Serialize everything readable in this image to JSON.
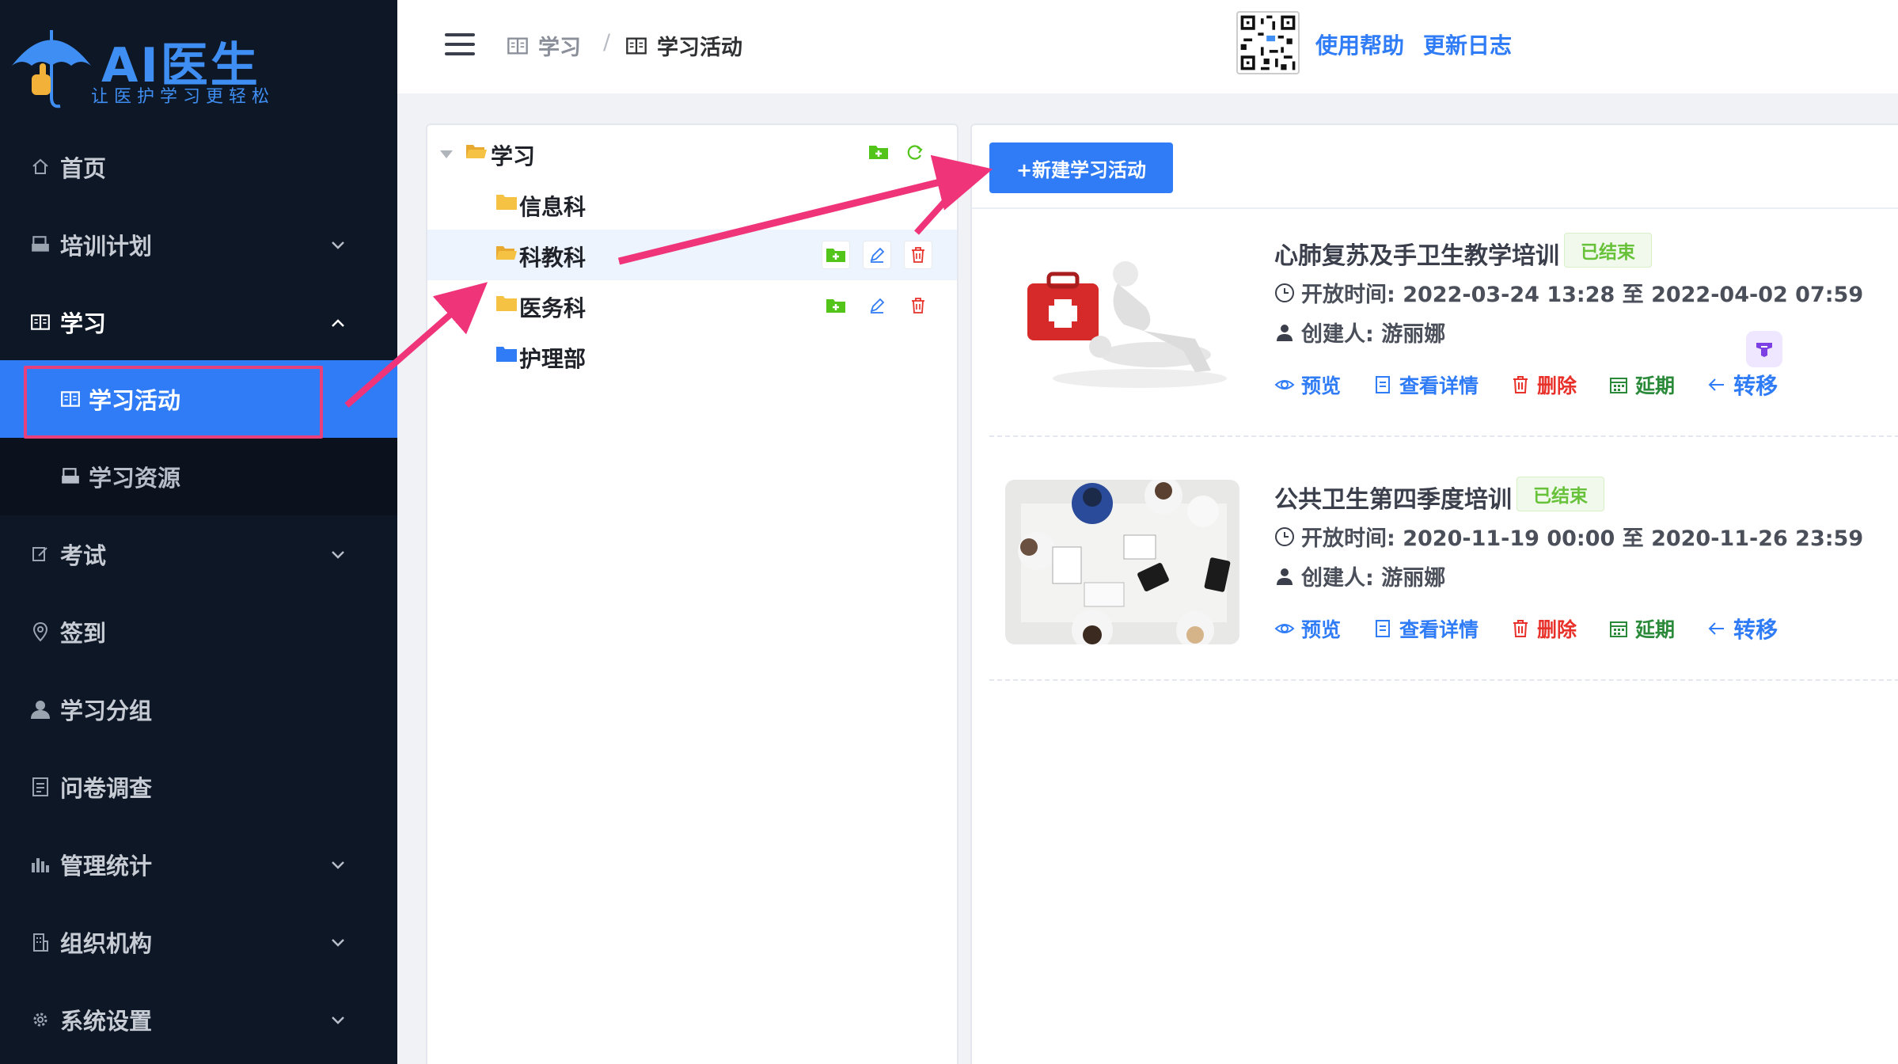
{
  "logo": {
    "title": "AI医生",
    "subtitle": "让医护学习更轻松"
  },
  "sidebar": {
    "items": [
      {
        "label": "首页",
        "icon": "home-icon",
        "has_caret": false
      },
      {
        "label": "培训计划",
        "icon": "printer-icon",
        "has_caret": true
      },
      {
        "label": "学习",
        "icon": "book-icon",
        "has_caret": true,
        "open": true
      },
      {
        "label": "考试",
        "icon": "edit-icon",
        "has_caret": true
      },
      {
        "label": "签到",
        "icon": "location-icon",
        "has_caret": false
      },
      {
        "label": "学习分组",
        "icon": "user-icon",
        "has_caret": false
      },
      {
        "label": "问卷调查",
        "icon": "document-icon",
        "has_caret": false
      },
      {
        "label": "管理统计",
        "icon": "bar-chart-icon",
        "has_caret": true
      },
      {
        "label": "组织机构",
        "icon": "building-icon",
        "has_caret": true
      },
      {
        "label": "系统设置",
        "icon": "gear-icon",
        "has_caret": true
      }
    ],
    "sub_items": [
      {
        "label": "学习活动",
        "icon": "book-icon",
        "active": true
      },
      {
        "label": "学习资源",
        "icon": "printer-icon",
        "active": false
      }
    ]
  },
  "header": {
    "breadcrumb": [
      {
        "label": "学习",
        "icon": "book-icon"
      },
      {
        "label": "学习活动",
        "icon": "book-icon"
      }
    ],
    "breadcrumb_separator": "/",
    "links": [
      "使用帮助",
      "更新日志"
    ]
  },
  "tree": {
    "root": {
      "label": "学习",
      "folder_color": "#f6c244"
    },
    "nodes": [
      {
        "label": "信息科",
        "folder_color": "#f6c244"
      },
      {
        "label": "科教科",
        "folder_color": "#f6c244",
        "selected": true
      },
      {
        "label": "医务科",
        "folder_color": "#f6c244"
      },
      {
        "label": "护理部",
        "folder_color": "#2f7cf6"
      }
    ]
  },
  "content": {
    "new_button": "+新建学习活动",
    "activities": [
      {
        "title": "心肺复苏及手卫生教学培训",
        "status": "已结束",
        "open_time_label": "开放时间:",
        "open_time": "2022-03-24 13:28 至 2022-04-02 07:59",
        "creator_label": "创建人:",
        "creator": "游丽娜",
        "thumb": "cpr-first-aid-image"
      },
      {
        "title": "公共卫生第四季度培训",
        "status": "已结束",
        "open_time_label": "开放时间:",
        "open_time": "2020-11-19 00:00 至 2020-11-26 23:59",
        "creator_label": "创建人:",
        "creator": "游丽娜",
        "thumb": "medical-meeting-image"
      }
    ],
    "actions": {
      "preview": "预览",
      "details": "查看详情",
      "delete": "删除",
      "extend": "延期",
      "transfer": "转移"
    }
  },
  "colors": {
    "sidebar_bg": "#0e1726",
    "accent": "#2f7cf6",
    "highlight": "#e8407a",
    "status_green": "#67c23a",
    "danger": "#e8312a"
  }
}
